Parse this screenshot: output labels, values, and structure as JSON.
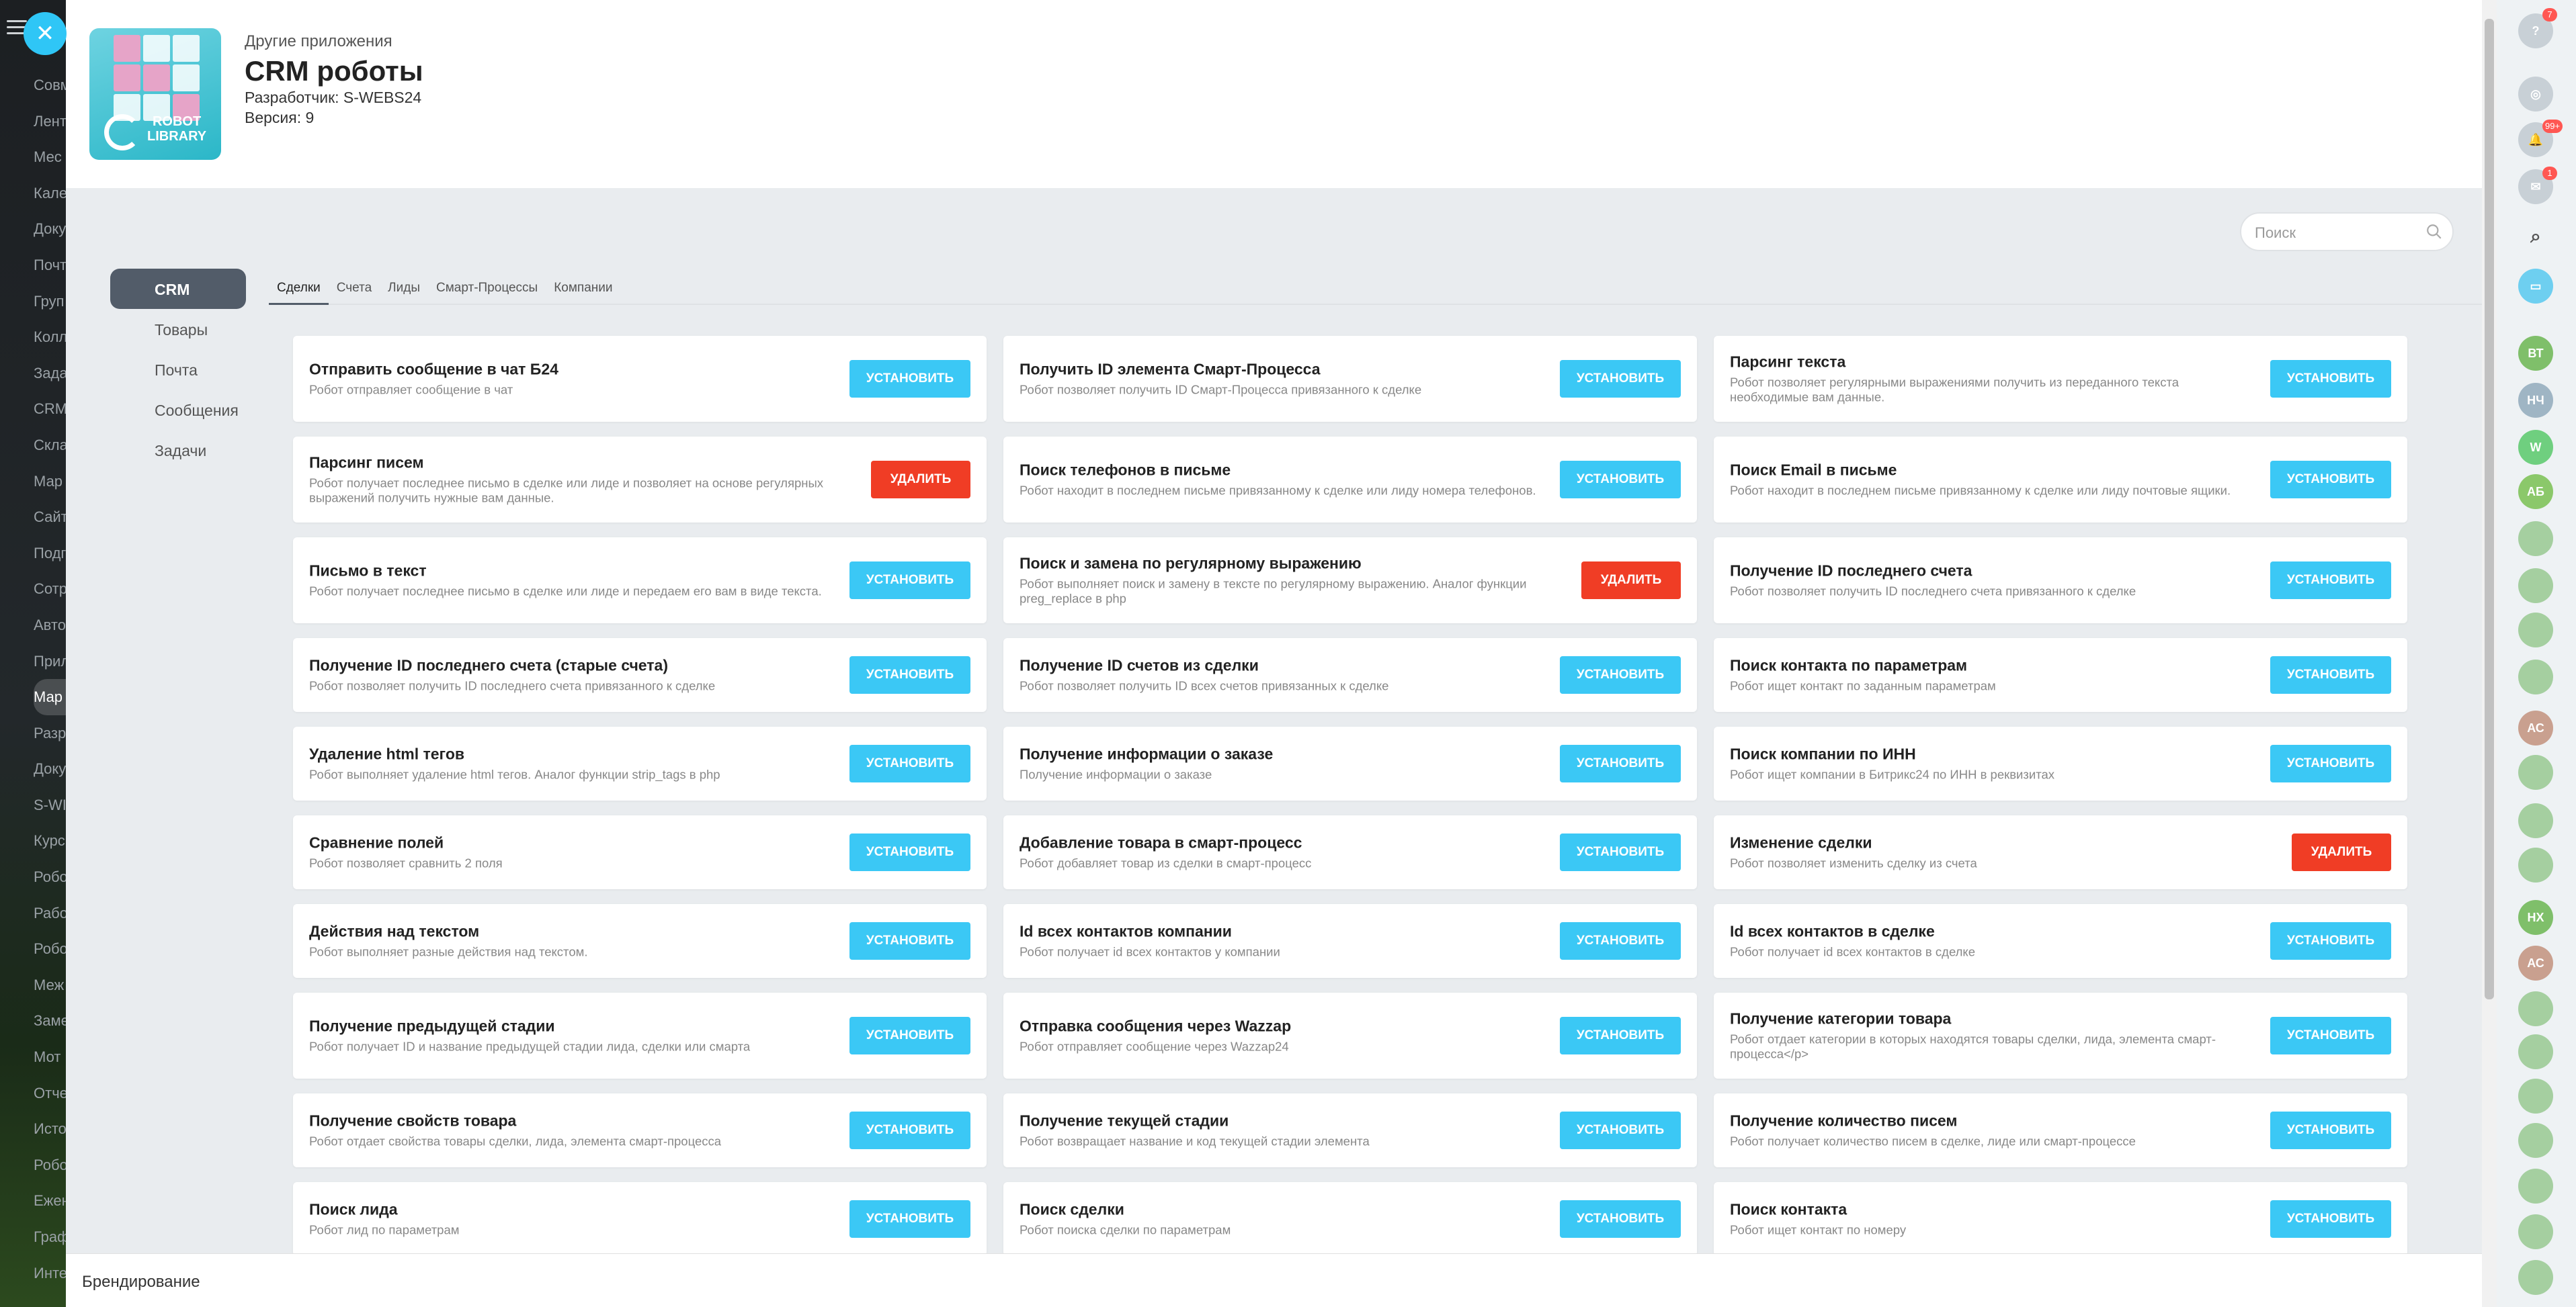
{
  "background_menu": [
    "Совм",
    "Лент",
    "Мес",
    "Кале",
    "Доку",
    "Почт",
    "Груп",
    "Колл",
    "Зада",
    "CRM",
    "Скла",
    "Мар",
    "Сайт",
    "Подг",
    "Сотр",
    "Авто",
    "Прил",
    "Мар",
    "Разр",
    "Доку",
    "S-WI",
    "Курс",
    "Робо",
    "Рабо",
    "Робо",
    "Меж",
    "Заме",
    "Мот",
    "Отче",
    "Исто",
    "Робо",
    "Ежен",
    "Граф",
    "Инте"
  ],
  "header": {
    "subtitle": "Другие приложения",
    "title": "CRM роботы",
    "developer": "Разработчик: S-WEBS24",
    "version": "Версия: 9",
    "logo_text_1": "ROBOT",
    "logo_text_2": "LIBRARY"
  },
  "search": {
    "placeholder": "Поиск"
  },
  "categories": [
    {
      "label": "CRM",
      "active": true
    },
    {
      "label": "Товары"
    },
    {
      "label": "Почта"
    },
    {
      "label": "Сообщения"
    },
    {
      "label": "Задачи"
    }
  ],
  "tabs": [
    {
      "label": "Сделки",
      "active": true
    },
    {
      "label": "Счета"
    },
    {
      "label": "Лиды"
    },
    {
      "label": "Смарт-Процессы"
    },
    {
      "label": "Компании"
    }
  ],
  "labels": {
    "install": "УСТАНОВИТЬ",
    "delete": "УДАЛИТЬ"
  },
  "cards": [
    {
      "title": "Отправить сообщение в чат Б24",
      "desc": "Робот отправляет сообщение в чат",
      "action": "install"
    },
    {
      "title": "Получить ID элемента Смарт-Процесса",
      "desc": "Робот позволяет получить ID Смарт-Процесса привязанного к сделке",
      "action": "install"
    },
    {
      "title": "Парсинг текста",
      "desc": "Робот позволяет регулярными выражениями получить из переданного текста необходимые вам данные.",
      "action": "install"
    },
    {
      "title": "Парсинг писем",
      "desc": "Робот получает последнее письмо в сделке или лиде и позволяет на основе регулярных выражений получить нужные вам данные.",
      "action": "delete"
    },
    {
      "title": "Поиск телефонов в письме",
      "desc": "Робот находит в последнем письме привязанному к сделке или лиду номера телефонов.",
      "action": "install"
    },
    {
      "title": "Поиск Email в письме",
      "desc": "Робот находит в последнем письме привязанному к сделке или лиду почтовые ящики.",
      "action": "install"
    },
    {
      "title": "Письмо в текст",
      "desc": "Робот получает последнее письмо в сделке или лиде и передаем его вам в виде текста.",
      "action": "install"
    },
    {
      "title": "Поиск и замена по регулярному выражению",
      "desc": "Робот выполняет поиск и замену в тексте по регулярному выражению. Аналог функции preg_replace в php",
      "action": "delete"
    },
    {
      "title": "Получение ID последнего счета",
      "desc": "Робот позволяет получить ID последнего счета привязанного к сделке",
      "action": "install"
    },
    {
      "title": "Получение ID последнего счета (старые счета)",
      "desc": "Робот позволяет получить ID последнего счета привязанного к сделке",
      "action": "install"
    },
    {
      "title": "Получение ID счетов из сделки",
      "desc": "Робот позволяет получить ID всех счетов привязанных к сделке",
      "action": "install"
    },
    {
      "title": "Поиск контакта по параметрам",
      "desc": "Робот ищет контакт по заданным параметрам",
      "action": "install"
    },
    {
      "title": "Удаление html тегов",
      "desc": "Робот выполняет удаление html тегов. Аналог функции strip_tags в php",
      "action": "install"
    },
    {
      "title": "Получение информации о заказе",
      "desc": "Получение информации о заказе",
      "action": "install"
    },
    {
      "title": "Поиск компании по ИНН",
      "desc": "Робот ищет компании в Битрикс24 по ИНН в реквизитах",
      "action": "install"
    },
    {
      "title": "Сравнение полей",
      "desc": "Робот позволяет сравнить 2 поля",
      "action": "install"
    },
    {
      "title": "Добавление товара в смарт-процесс",
      "desc": "Робот добавляет товар из сделки в смарт-процесс",
      "action": "install"
    },
    {
      "title": "Изменение сделки",
      "desc": "Робот позволяет изменить сделку из счета",
      "action": "delete"
    },
    {
      "title": "Действия над текстом",
      "desc": "Робот выполняет разные действия над текстом.",
      "action": "install"
    },
    {
      "title": "Id всех контактов компании",
      "desc": "Робот получает id всех контактов у компании",
      "action": "install"
    },
    {
      "title": "Id всех контактов в сделке",
      "desc": "Робот получает id всех контактов в сделке",
      "action": "install"
    },
    {
      "title": "Получение предыдущей стадии",
      "desc": "Робот получает ID и название предыдущей стадии лида, сделки или смарта",
      "action": "install"
    },
    {
      "title": "Отправка сообщения через Wazzap",
      "desc": "Робот отправляет сообщение через Wazzap24",
      "action": "install"
    },
    {
      "title": "Получение категории товара",
      "desc": "Робот отдает категории в которых находятся товары сделки, лида, элемента смарт-процесса</p>",
      "action": "install"
    },
    {
      "title": "Получение свойств товара",
      "desc": "Робот отдает свойства товары сделки, лида, элемента смарт-процесса",
      "action": "install"
    },
    {
      "title": "Получение текущей стадии",
      "desc": "Робот возвращает название и код текущей стадии элемента",
      "action": "install"
    },
    {
      "title": "Получение количество писем",
      "desc": "Робот получает количество писем в сделке, лиде или смарт-процессе",
      "action": "install"
    },
    {
      "title": "Поиск лида",
      "desc": "Робот лид по параметрам",
      "action": "install"
    },
    {
      "title": "Поиск сделки",
      "desc": "Робот поиска сделки по параметрам",
      "action": "install"
    },
    {
      "title": "Поиск контакта",
      "desc": "Робот ищет контакт по номеру",
      "action": "install"
    }
  ],
  "footer": {
    "label": "Брендирование"
  },
  "right_rail": {
    "badges": {
      "help": "7",
      "notifications": "99+",
      "chat": "1"
    },
    "avatars": [
      "ВТ",
      "НЧ",
      "W",
      "АБ",
      "АС",
      "НХ",
      "АС"
    ]
  },
  "colors": {
    "install": "#3bc8f5",
    "delete": "#f03d25",
    "active_category": "#525c69",
    "close_button": "#2fc6f6"
  }
}
